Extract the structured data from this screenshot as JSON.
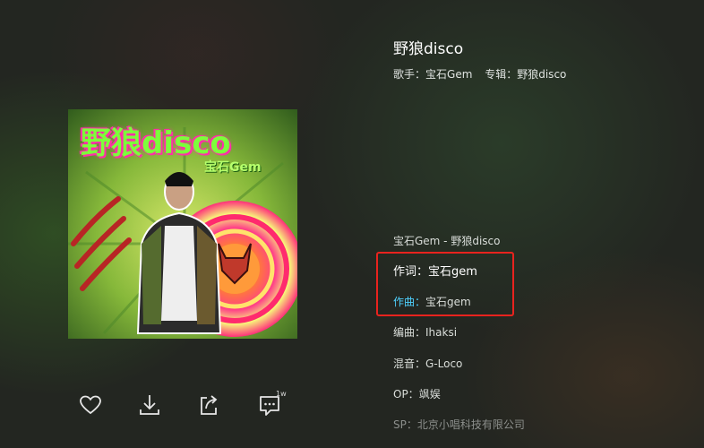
{
  "song": {
    "title": "野狼disco",
    "artist_label": "歌手：",
    "artist": "宝石Gem",
    "album_label": "专辑：",
    "album": "野狼disco"
  },
  "album_art": {
    "title_text": "野狼disco",
    "artist_text": "宝石Gem"
  },
  "lyrics_header": "宝石Gem - 野狼disco",
  "credits": [
    {
      "label": "作词：",
      "value": "宝石gem"
    },
    {
      "label": "作曲：",
      "value": "宝石gem"
    },
    {
      "label": "编曲：",
      "value": "Ihaksi"
    },
    {
      "label": "混音：",
      "value": "G-Loco"
    },
    {
      "label": "OP：",
      "value": "飒娱"
    },
    {
      "label": "SP：",
      "value": "北京小唱科技有限公司"
    }
  ],
  "actions": {
    "like_icon": "heart-icon",
    "download_icon": "download-icon",
    "share_icon": "share-icon",
    "comment_icon": "comment-icon",
    "comment_count": "1w"
  },
  "colors": {
    "highlight_box": "#e8231e",
    "composer_label": "#4fd1ff"
  }
}
